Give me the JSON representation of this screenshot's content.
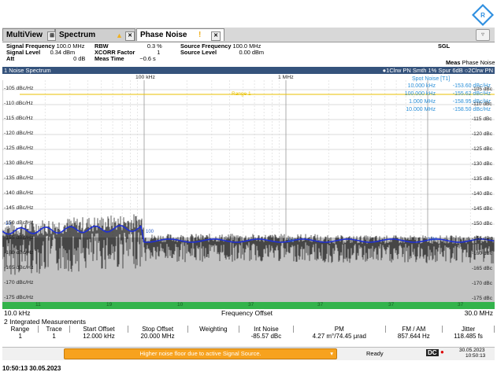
{
  "tabs": [
    {
      "label": "MultiView"
    },
    {
      "label": "Spectrum"
    },
    {
      "label": "Phase Noise"
    }
  ],
  "params": {
    "signal_frequency_label": "Signal Frequency",
    "signal_frequency": "100.0 MHz",
    "signal_level_label": "Signal Level",
    "signal_level": "0.34 dBm",
    "att_label": "Att",
    "att": "0 dB",
    "rbw_label": "RBW",
    "rbw": "0.3 %",
    "xcorr_label": "XCORR Factor",
    "xcorr": "1",
    "meas_time_label": "Meas Time",
    "meas_time": "~0.6 s",
    "source_freq_label": "Source Frequency",
    "source_freq": "100.0 MHz",
    "source_level_label": "Source Level",
    "source_level": "0.00 dBm",
    "sgl": "SGL",
    "meas_label": "Meas",
    "meas": "Phase Noise"
  },
  "window": {
    "title": "1 Noise Spectrum",
    "trace_info": "●1Clrw PN Smth 1% Spur 6dB  ○2Clrw PN"
  },
  "plot": {
    "range_label": "Range 1",
    "y_ticks_left": [
      "-105 dBc/Hz",
      "-110 dBc/Hz",
      "-115 dBc/Hz",
      "-120 dBc/Hz",
      "-125 dBc/Hz",
      "-130 dBc/Hz",
      "-135 dBc/Hz",
      "-140 dBc/Hz",
      "-145 dBc/Hz",
      "-150 dBc/Hz",
      "-155 dBc/Hz",
      "-160 dBc/Hz",
      "-165 dBc/Hz",
      "-170 dBc/Hz",
      "-175 dBc/Hz"
    ],
    "y_ticks_right": [
      "-105 dBc",
      "-110 dBc",
      "-115 dBc",
      "-120 dBc",
      "-125 dBc",
      "-130 dBc",
      "-135 dBc",
      "-140 dBc",
      "-145 dBc",
      "-150 dBc",
      "-155 dBc",
      "-160 dBc",
      "-165 dBc",
      "-170 dBc",
      "-175 dBc"
    ],
    "decade_labels": [
      "100 kHz",
      "1 MHz"
    ],
    "spot_title": "Spot Noise [T1]",
    "spot_noise": [
      {
        "freq": "10.000 kHz",
        "value": "-153.60 dBc/Hz"
      },
      {
        "freq": "100.000 kHz",
        "value": "-155.62 dBc/Hz"
      },
      {
        "freq": "1.000 MHz",
        "value": "-158.95 dBc/Hz"
      },
      {
        "freq": "10.000 MHz",
        "value": "-158.50 dBc/Hz"
      }
    ],
    "markers": [
      "10",
      "100",
      "1M",
      "10M"
    ],
    "bottom_numbers": [
      "11",
      "19",
      "10",
      "37",
      "37",
      "37",
      "37"
    ],
    "x_start": "10.0 kHz",
    "x_label": "Frequency Offset",
    "x_stop": "30.0 MHz"
  },
  "integrated": {
    "title": "2 Integrated Measurements",
    "headers": [
      "Range",
      "Trace",
      "Start Offset",
      "Stop Offset",
      "Weighting",
      "Int Noise",
      "PM",
      "FM / AM",
      "Jitter"
    ],
    "row": [
      "1",
      "1",
      "12.000 kHz",
      "20.000 MHz",
      "",
      "-85.57 dBc",
      "4.27 m°/74.45 µrad",
      "857.644 Hz",
      "118.485 fs"
    ]
  },
  "status": {
    "message": "Higher noise floor due to active Signal Source.",
    "ready": "Ready",
    "dc": "DC",
    "date": "30.05.2023",
    "time": "10:50:13"
  },
  "footer_timestamp": "10:50:13  30.05.2023",
  "colors": {
    "trace": "#1e2fd6",
    "spot": "#2a8fd8",
    "range_line": "#e8c000",
    "freq_bar": "#33b34b",
    "title_bar": "#35537c",
    "msg": "#f7a21e"
  }
}
